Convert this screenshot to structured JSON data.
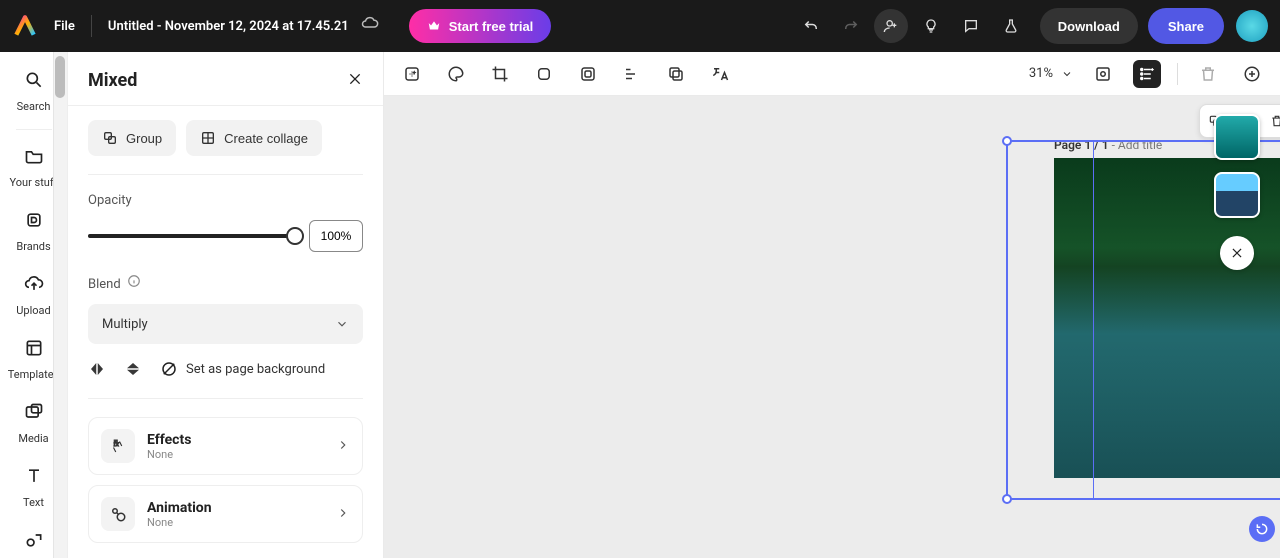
{
  "topbar": {
    "file": "File",
    "docname": "Untitled - November 12, 2024 at 17.45.21",
    "trial": "Start free trial",
    "download": "Download",
    "share": "Share"
  },
  "rail": [
    {
      "label": "Search"
    },
    {
      "label": "Your stuff"
    },
    {
      "label": "Brands"
    },
    {
      "label": "Upload"
    },
    {
      "label": "Templates"
    },
    {
      "label": "Media"
    },
    {
      "label": "Text"
    }
  ],
  "panel": {
    "title": "Mixed",
    "group": "Group",
    "collage": "Create collage",
    "opacity_label": "Opacity",
    "opacity_value": "100%",
    "blend_label": "Blend",
    "blend_value": "Multiply",
    "set_bg": "Set as page background",
    "effects": {
      "title": "Effects",
      "value": "None"
    },
    "animation": {
      "title": "Animation",
      "value": "None"
    }
  },
  "ctx": {
    "zoom": "31%"
  },
  "canvas": {
    "page": "Page 1 / 1",
    "add": " - Add title"
  },
  "float": {
    "group": "Group"
  }
}
